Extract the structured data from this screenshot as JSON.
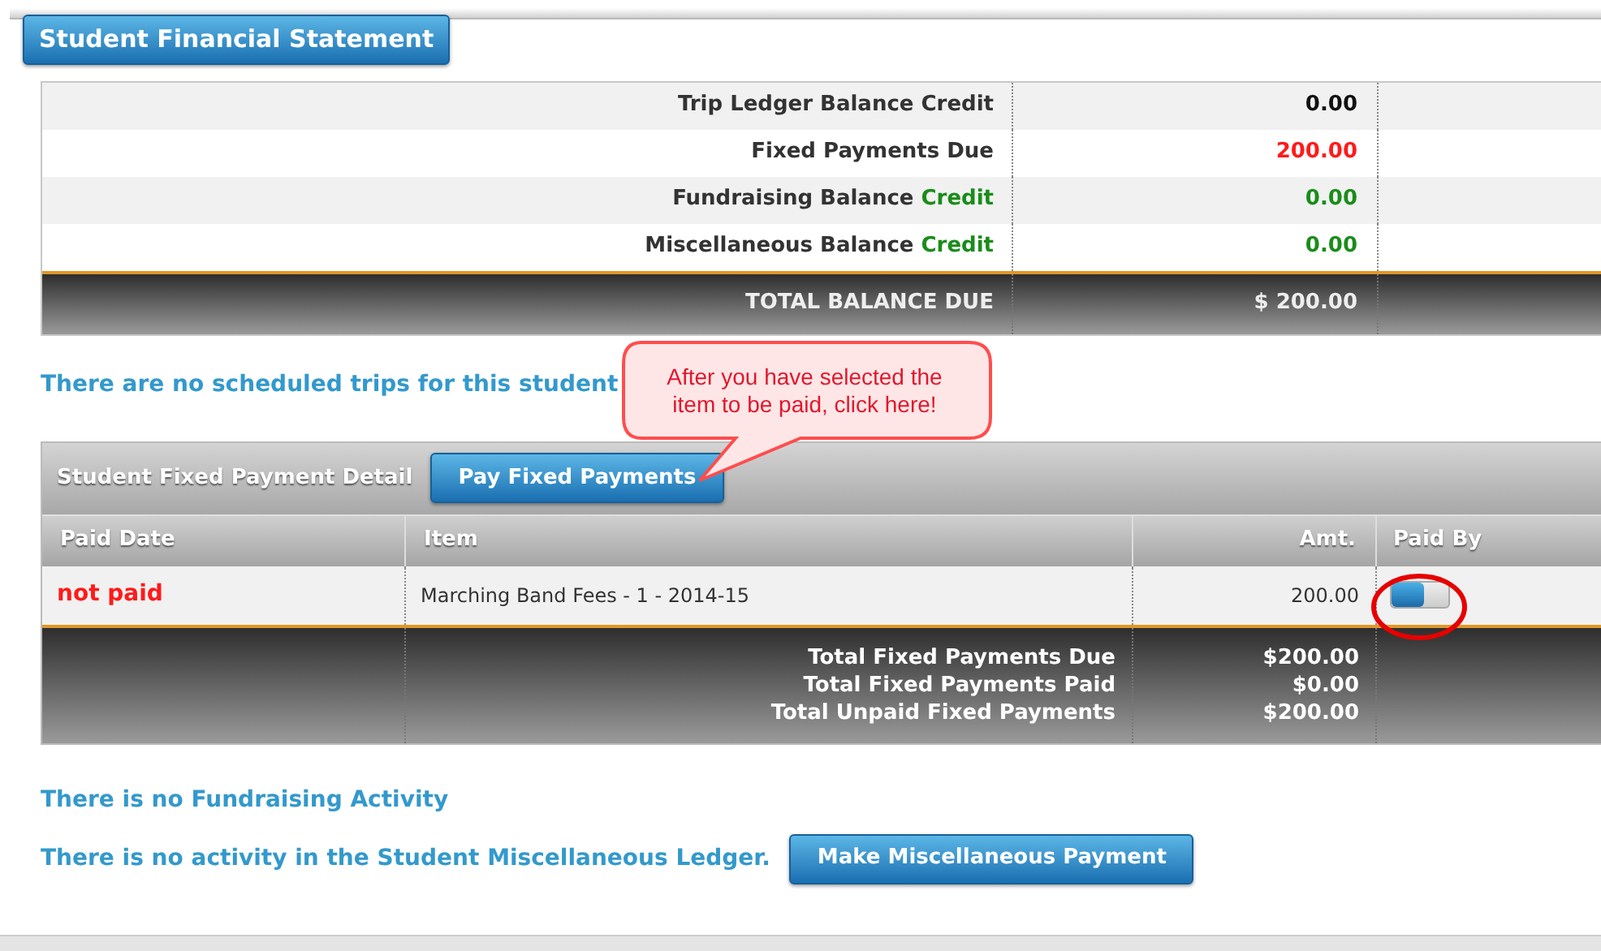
{
  "header": {
    "title": "Student Financial Statement"
  },
  "balances": [
    {
      "label": "Trip Ledger Balance Credit",
      "value": "0.00",
      "color": "#111111"
    },
    {
      "label": "Fixed Payments Due",
      "value": "200.00",
      "color": "#ff1a1a"
    },
    {
      "label": "Fundraising Balance",
      "tag": "Credit",
      "value": "0.00",
      "color": "#1a8c1a"
    },
    {
      "label": "Miscellaneous Balance",
      "tag": "Credit",
      "value": "0.00",
      "color": "#1a8c1a"
    }
  ],
  "total_balance": {
    "label": "TOTAL BALANCE DUE",
    "value": "$ 200.00"
  },
  "trips_message": "There are no scheduled trips for this student",
  "callout": "After you have selected the item to be paid, click here!",
  "fixed_payments": {
    "title": "Student Fixed Payment Detail",
    "pay_button": "Pay Fixed Payments",
    "columns": [
      "Paid Date",
      "Item",
      "Amt.",
      "Paid By"
    ],
    "rows": [
      {
        "paid_date": "not paid",
        "item": "Marching Band Fees - 1 - 2014-15",
        "amount": "200.00",
        "paid_by_on": true
      }
    ],
    "totals": [
      {
        "label": "Total Fixed Payments Due",
        "value": "$200.00"
      },
      {
        "label": "Total Fixed Payments Paid",
        "value": "$0.00"
      },
      {
        "label": "Total Unpaid Fixed Payments",
        "value": "$200.00"
      }
    ]
  },
  "fundraising_message": "There is no Fundraising Activity",
  "misc_message": "There is no activity in the Student Miscellaneous Ledger.",
  "misc_button": "Make Miscellaneous Payment"
}
